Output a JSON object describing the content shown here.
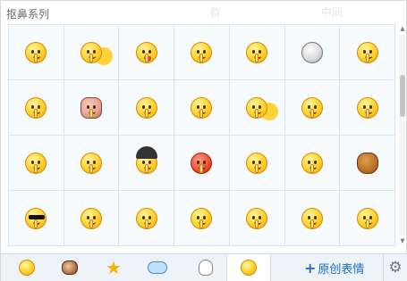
{
  "panel": {
    "title": "抠鼻系列",
    "faded_hints": [
      "群",
      "中间"
    ]
  },
  "grid": {
    "rows": [
      [
        "pick-nose",
        "pick-nose-pair",
        "pick-nose-tongue",
        "pick-nose-sweat",
        "pick-nose-cover",
        "pick-nose-skull",
        "pick-nose-surprised"
      ],
      [
        "pick-nose-wink",
        "pick-nose-pig",
        "pick-nose-look",
        "pick-nose-book",
        "pick-nose-duo",
        "pick-nose-love",
        "pick-nose-angry"
      ],
      [
        "pick-nose-shock",
        "pick-nose-hands",
        "pick-nose-hat",
        "pick-nose-red",
        "pick-nose-cry",
        "pick-nose-heart",
        "pick-nose-poop"
      ],
      [
        "pick-nose-cool",
        "pick-nose-smile",
        "pick-nose-bone",
        "pick-nose-scared",
        "pick-nose-kiss",
        "pick-nose-silly",
        "pick-nose-bow"
      ]
    ]
  },
  "tabs": [
    {
      "name": "tab-classic-emoji",
      "icon": "smiley-icon"
    },
    {
      "name": "tab-monkey",
      "icon": "monkey-icon"
    },
    {
      "name": "tab-favorites",
      "icon": "star-icon",
      "glyph": "★"
    },
    {
      "name": "tab-bubble",
      "icon": "bubble-icon"
    },
    {
      "name": "tab-rabbit",
      "icon": "rabbit-icon"
    },
    {
      "name": "tab-pick-nose",
      "icon": "pick-nose-icon",
      "active": true
    }
  ],
  "create_button": {
    "plus": "+",
    "label": "原创表情"
  },
  "settings": {
    "icon": "gear-icon",
    "glyph": "⚙"
  },
  "colors": {
    "accent": "#1a6fd0",
    "grid_line": "#d8e4ee",
    "tabbar_bg": "#eef3f8"
  }
}
